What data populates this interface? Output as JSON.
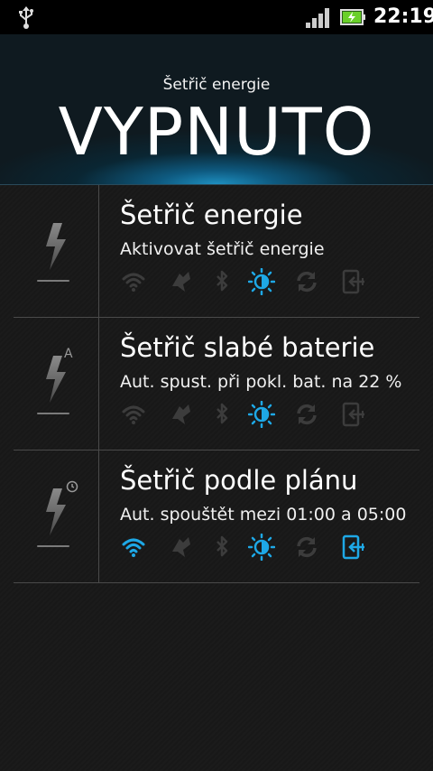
{
  "status_bar": {
    "time": "22:19",
    "icons": [
      "usb-icon",
      "signal-icon",
      "battery-charging-icon"
    ]
  },
  "header": {
    "subtitle": "Šetřič energie",
    "status": "VYPNUTO"
  },
  "modes": [
    {
      "title": "Šetřič energie",
      "subtitle": "Aktivovat šetřič energie",
      "icon": "bolt-icon",
      "toggles": {
        "wifi": false,
        "sync_data": false,
        "bluetooth": false,
        "brightness": true,
        "auto_sync": false,
        "screen_timeout": false
      }
    },
    {
      "title": "Šetřič slabé baterie",
      "subtitle": "Aut. spust. při pokl. bat. na 22 %",
      "icon": "bolt-auto-icon",
      "badge": "A",
      "toggles": {
        "wifi": false,
        "sync_data": false,
        "bluetooth": false,
        "brightness": true,
        "auto_sync": false,
        "screen_timeout": false
      }
    },
    {
      "title": "Šetřič podle plánu",
      "subtitle": "Aut. spouštět mezi 01:00 a 05:00",
      "icon": "bolt-schedule-icon",
      "toggles": {
        "wifi": true,
        "sync_data": false,
        "bluetooth": false,
        "brightness": true,
        "auto_sync": false,
        "screen_timeout": true
      }
    }
  ],
  "colors": {
    "active": "#1ea8e6",
    "inactive": "#3c3c3c",
    "accent": "#1e8fc0"
  }
}
